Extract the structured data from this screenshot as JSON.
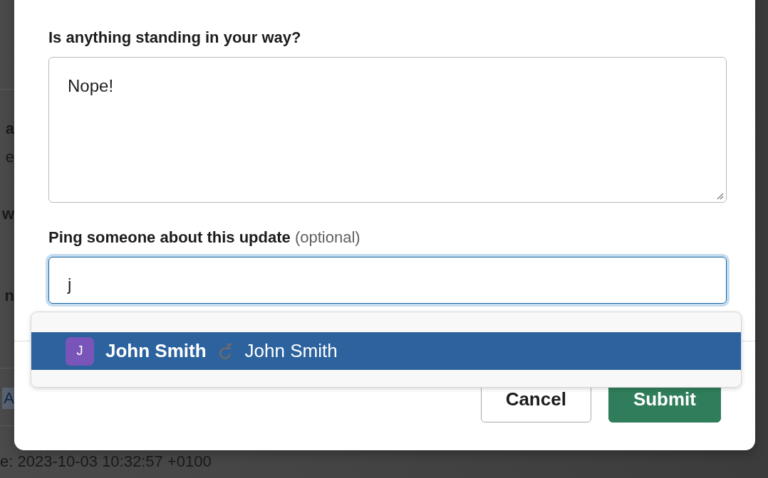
{
  "background": {
    "fragments": [
      {
        "text": "a",
        "kind": "bold"
      },
      {
        "text": "e",
        "kind": "plain"
      },
      {
        "text": "w",
        "kind": "bold"
      },
      {
        "text": "n",
        "kind": "bold"
      },
      {
        "text": "A",
        "kind": "mention"
      }
    ],
    "footer_text": "e: 2023-10-03 10:32:57 +0100"
  },
  "dialog": {
    "question": {
      "label": "Is anything standing in your way?",
      "value": "Nope!"
    },
    "ping": {
      "label": "Ping someone about this update",
      "hint": "(optional)",
      "value": "j"
    },
    "suggestions": [
      {
        "initial": "J",
        "name": "John Smith",
        "display_name": "John Smith",
        "selected": true
      }
    ],
    "buttons": [
      {
        "label": "Cancel",
        "kind": "secondary"
      },
      {
        "label": "Submit",
        "kind": "primary"
      }
    ]
  }
}
